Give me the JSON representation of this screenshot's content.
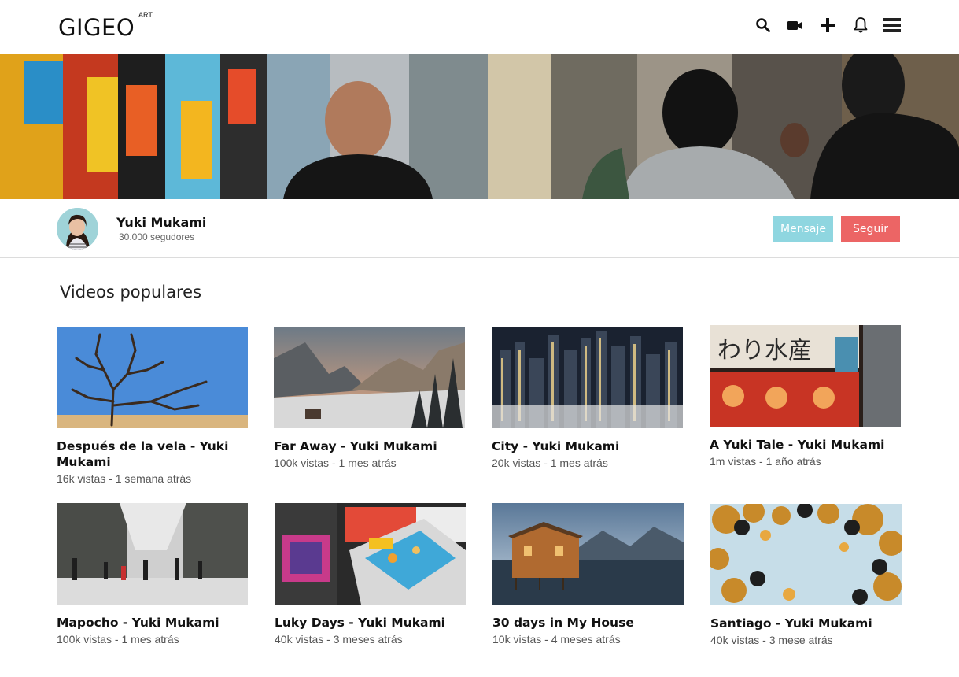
{
  "header": {
    "logo": "GIGEO",
    "logo_sup": "ART",
    "icons": [
      "search-icon",
      "video-camera-icon",
      "plus-icon",
      "bell-icon",
      "menu-icon"
    ]
  },
  "profile": {
    "name": "Yuki Mukami",
    "followers": "30.000 segudores",
    "message_label": "Mensaje",
    "follow_label": "Seguir"
  },
  "section": {
    "title": "Videos populares"
  },
  "videos": [
    {
      "title": "Después de la vela - Yuki Mukami",
      "meta": "16k vistas - 1 semana atrás"
    },
    {
      "title": "Far Away - Yuki Mukami",
      "meta": "100k vistas - 1 mes atrás"
    },
    {
      "title": "City - Yuki Mukami",
      "meta": "20k vistas - 1 mes atrás"
    },
    {
      "title": "A Yuki Tale - Yuki Mukami",
      "meta": "1m vistas - 1 año atrás"
    },
    {
      "title": "Mapocho - Yuki Mukami",
      "meta": "100k vistas - 1 mes atrás"
    },
    {
      "title": "Luky Days - Yuki Mukami",
      "meta": "40k vistas - 3 meses atrás"
    },
    {
      "title": "30 days in My House",
      "meta": "10k vistas - 4 meses atrás"
    },
    {
      "title": "Santiago - Yuki Mukami",
      "meta": "40k vistas - 3 mese atrás"
    }
  ],
  "colors": {
    "message_button": "#8fd6e0",
    "follow_button": "#ec6565",
    "divider": "#dcdcdc"
  }
}
